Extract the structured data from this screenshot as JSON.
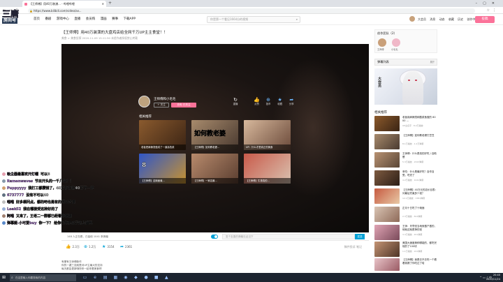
{
  "browser": {
    "tab_title": "【王师傅】用40万装潢... - 哔哩哔哩",
    "url": "https://www.bilibili.com/video/av...",
    "app_label": "下载APP"
  },
  "logo": {
    "line1": "三唐",
    "line2": "房间号"
  },
  "site": {
    "nav": [
      "首页",
      "番剧",
      "游戏中心",
      "直播",
      "会员购",
      "漫画",
      "赛事",
      "下载APP"
    ],
    "search_placeholder": "你是第一个看见1664分的视频",
    "user_links": [
      "大会员",
      "消息",
      "动态",
      "收藏",
      "历史",
      "创作中心"
    ],
    "upload_label": "投稿"
  },
  "video": {
    "title": "【王师傅】用40万装潢的大盘鸡店给全网千万UP主主食堂！！",
    "meta": "美食 > 美食侦探   2020-11-09 15:11:50   未经作者授权禁止转载"
  },
  "player": {
    "up_name": "王师傅和小毛毛",
    "follow_label": "+ 关注",
    "charge_label": "充电 已关注",
    "replay_label": "重播",
    "actions": [
      {
        "icon": "👍",
        "label": "点赞"
      },
      {
        "icon": "⊕",
        "label": "投币"
      },
      {
        "icon": "★",
        "label": "收藏"
      },
      {
        "icon": "➦",
        "label": "分享"
      }
    ],
    "related_header": "相关推荐",
    "cards": [
      {
        "big": "",
        "cap": "老板把麻辣烫做成了一道高档菜"
      },
      {
        "big": "如何教老婆",
        "cap": "【王师傅】如何教老婆..."
      },
      {
        "big": "",
        "cap": "UP：什么才是真正的美食"
      },
      {
        "big": "8",
        "cap": "【王师傅】这碗面竟..."
      },
      {
        "big": "",
        "cap": "【王师傅】一家店最..."
      },
      {
        "big": "",
        "cap": "【王师傅】牛排真的..."
      }
    ]
  },
  "controls": {
    "watching": "148 人正在看，已装填 1041 条弹幕",
    "danmu_placeholder": "发个友善的弹幕见证当下",
    "send_label": "发送"
  },
  "ops": [
    {
      "icon": "👍",
      "value": "2.3万"
    },
    {
      "icon": "⊕",
      "value": "1.2万"
    },
    {
      "icon": "★",
      "value": "3154"
    },
    {
      "icon": "➦",
      "value": "2361"
    }
  ],
  "ops_more": "稿件投诉  笔记",
  "desc": [
    "有梗有王师傅新作",
    "你的一键三连就是对UP主最大的支持",
    "每天都会更新哦快来一起来看美食吧"
  ],
  "right": {
    "multi_up_title": "创作团队（2）",
    "multi_up_names": [
      "王师傅",
      "小毛毛"
    ],
    "danmu_list_label": "弹幕列表",
    "danmu_list_right": "展开",
    "ad_tag": "大会员",
    "related_title": "相关推荐",
    "related": [
      {
        "tt": "",
        "t": "老板用麻辣烫和酸菜鱼做的 80 00 ...",
        "m": "UP主名字 · 8.2万播放"
      },
      {
        "tt": "",
        "t": "【王师傅】如何教老婆打豆豆",
        "m": "8.1万播放 · 1.2万弹幕"
      },
      {
        "tt": "",
        "t": "王师傅：什么是真的好吃 / 自助餐",
        "m": "5.3万播放 · 2343弹幕"
      },
      {
        "tt": "",
        "t": "来吃：什么是最好吃？自作自受，吃完了",
        "m": "4.2万播放 · 1041弹幕"
      },
      {
        "tt": "",
        "t": "【王师傅】40万元的店价目表：问最后究竟多少钱？",
        "m": "12.1万播放 · 3381弹幕"
      },
      {
        "tt": "",
        "t": "正月十日吃了十碗面",
        "m": "2.3万播放 · 812弹幕"
      },
      {
        "tt": "",
        "t": "王师：牙膏但当地就做户做的，他就这就是挣的钱",
        "m": "3.3万播放 · 451弹幕"
      },
      {
        "tt": "",
        "t": "【王师傅】吃的是蛋白？我就吃蛋白质 ！（",
        "m": "6.6万播放 · 931弹幕"
      },
      {
        "tt": "",
        "t": "",
        "m": ""
      },
      {
        "tt": "",
        "t": "美国大速度美种哪能的，都吃完他的了100块",
        "m": "1.1万播放 · 221弹幕"
      },
      {
        "tt": "",
        "t": "【王师傅】我是去不去吃一个看看我赛了你吃过了哈",
        "m": "2.0万播放 · 331弹幕"
      }
    ]
  },
  "overlay": [
    {
      "user": "吸尘器最喜欢开灯帽",
      "text": "可以8"
    },
    {
      "user": "Ramenwaves",
      "text": "节目开头的一千几块？！"
    },
    {
      "user": "Puppyyyy",
      "text": "我打工都攒钱了，40万你们的40万不一样"
    },
    {
      "user": "6737777",
      "text": "没有不可以40"
    },
    {
      "user": "喵喵",
      "text": "好多想问点，都的吧也是有的可以才贵"
    },
    {
      "user": "Leak52",
      "text": "我在哪接受这种好的了"
    },
    {
      "user": "阿喵",
      "text": "又来了，王老二一群都已经看你格桐"
    },
    {
      "user": "弹幕姬-小可爱buy",
      "text": "你一下？ 给你们炸肥瓜子边上磕吧"
    }
  ],
  "taskbar": {
    "search_placeholder": "在这里输入你要搜索的内容",
    "clock_time": "20:40",
    "clock_date": "2020/11/24"
  }
}
